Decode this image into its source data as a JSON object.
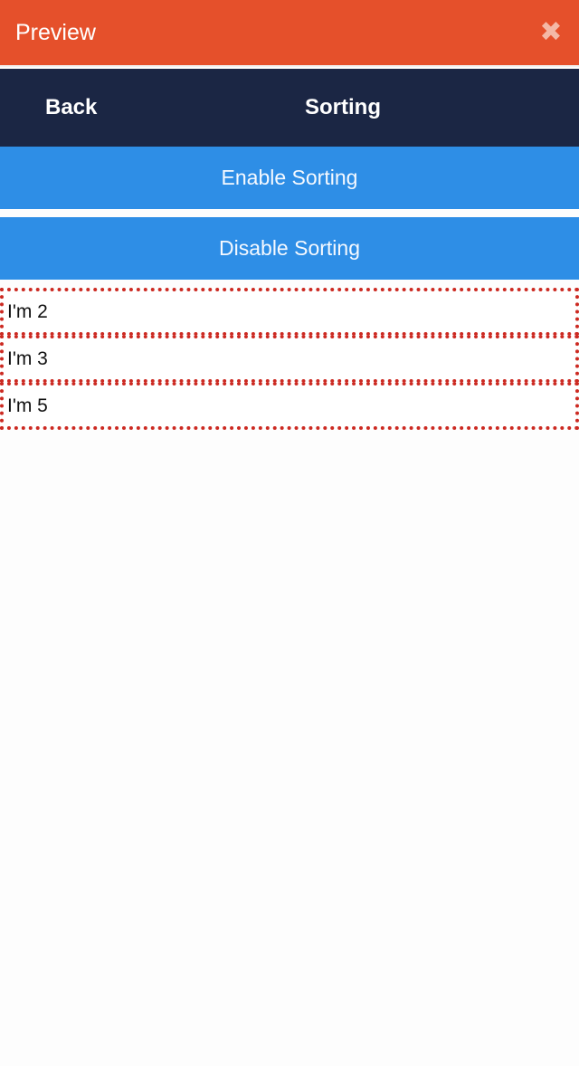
{
  "preview": {
    "title": "Preview",
    "close_glyph": "✖",
    "close_icon": "close-icon"
  },
  "nav": {
    "back_label": "Back",
    "title": "Sorting"
  },
  "actions": {
    "enable_label": "Enable Sorting",
    "disable_label": "Disable Sorting"
  },
  "list": {
    "items": [
      {
        "label": "I'm 2"
      },
      {
        "label": "I'm 3"
      },
      {
        "label": "I'm 5"
      }
    ]
  },
  "colors": {
    "preview_bar": "#e5502b",
    "nav_bar": "#1b2644",
    "button": "#2e8ee6",
    "item_border": "#cc2a22"
  }
}
